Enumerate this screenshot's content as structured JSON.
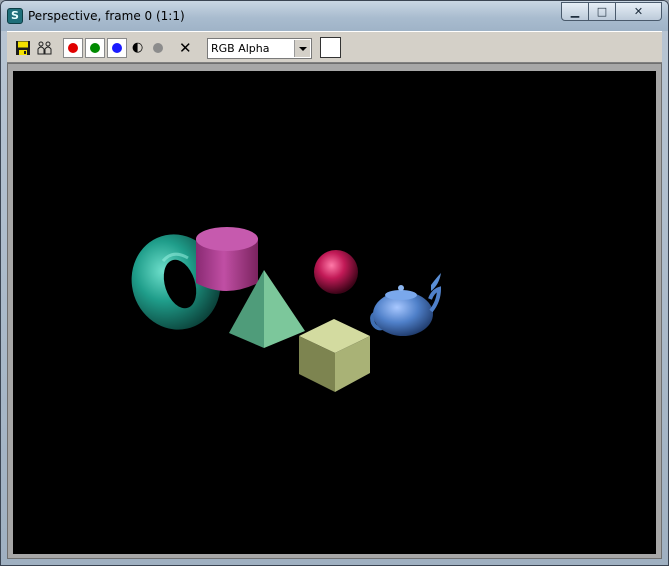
{
  "window": {
    "title": "Perspective, frame 0 (1:1)",
    "app_icon_glyph": "S",
    "controls": {
      "minimize": "▁",
      "maximize": "□",
      "close": "✕"
    }
  },
  "toolbar": {
    "save_icon": "floppy-disk-icon",
    "clone_icon": "clone-window-icon",
    "channels": [
      {
        "name": "red-channel",
        "color": "#e00000"
      },
      {
        "name": "green-channel",
        "color": "#008a00"
      },
      {
        "name": "blue-channel",
        "color": "#1a1aff"
      }
    ],
    "mono_glyph": "◐",
    "clear_glyph": "✕",
    "channel_select": {
      "selected": "RGB Alpha"
    },
    "swatch_color": "#ffffff"
  },
  "render": {
    "background": "#000000",
    "objects": [
      "torus",
      "cylinder",
      "sphere",
      "pyramid",
      "teapot",
      "box"
    ]
  }
}
